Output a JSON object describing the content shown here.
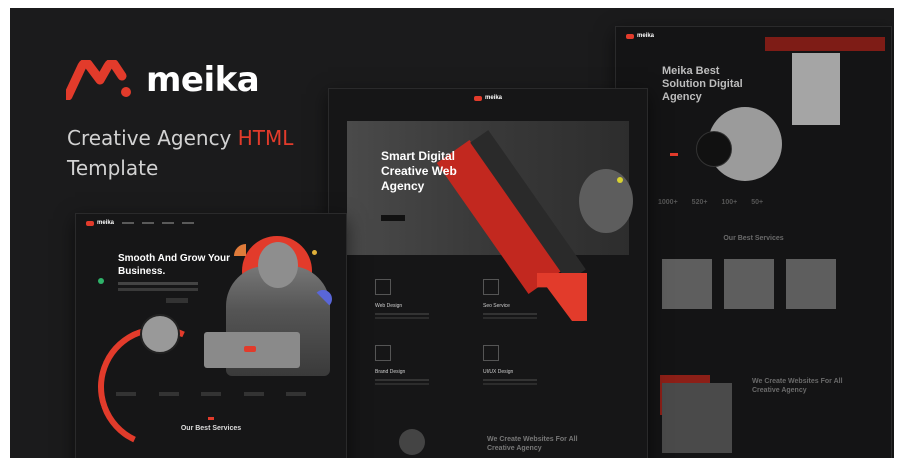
{
  "hero": {
    "brand_name": "meika",
    "tagline_main": "Creative Agency",
    "tagline_accent": "HTML",
    "tagline_rest": "Template",
    "accent_color": "#e23b2b"
  },
  "mock_left": {
    "logo": "meika",
    "headline": "Smooth And Grow Your Business.",
    "section_title": "Our Best Services"
  },
  "mock_center": {
    "logo": "meika",
    "headline": "Smart Digital Creative Web Agency",
    "services": [
      "Web Design",
      "Seo Service",
      "Brand Design",
      "UI/UX Design"
    ],
    "bottom_title": "We Create Websites For All Creative Agency"
  },
  "mock_right": {
    "logo": "meika",
    "headline": "Meika Best Solution Digital Agency",
    "stats": [
      "1000+",
      "520+",
      "100+",
      "50+"
    ],
    "section_title": "Our Best Services",
    "bottom_title": "We Create Websites For All Creative Agency"
  }
}
